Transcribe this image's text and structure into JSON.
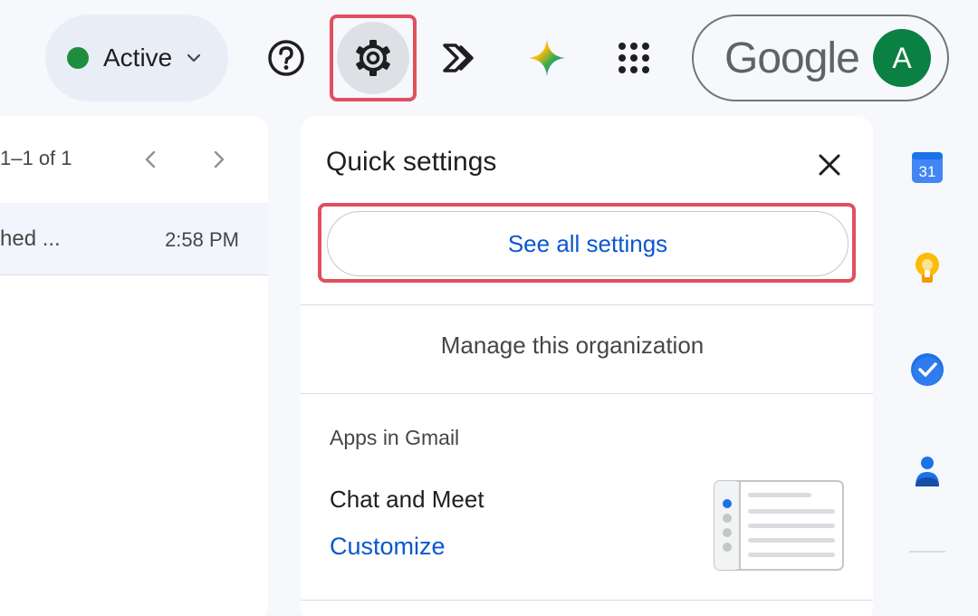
{
  "header": {
    "status_label": "Active",
    "status_color": "#1e8e3e",
    "icons": [
      "help-icon",
      "settings-icon",
      "apps-script-icon",
      "gemini-icon",
      "apps-grid-icon"
    ],
    "account_logo_text": "Google",
    "avatar_initial": "A",
    "avatar_color": "#0b8043"
  },
  "list": {
    "pager_text": "1–1 of 1",
    "rows": [
      {
        "snippet": "hed ...",
        "time": "2:58 PM"
      }
    ]
  },
  "quick_settings": {
    "title": "Quick settings",
    "see_all_label": "See all settings",
    "manage_org_label": "Manage this organization",
    "apps_heading": "Apps in Gmail",
    "chat_meet_label": "Chat and Meet",
    "customize_label": "Customize"
  },
  "side_rail": {
    "calendar_date": "31",
    "icons": [
      "calendar-icon",
      "keep-icon",
      "tasks-icon",
      "contacts-icon"
    ]
  },
  "colors": {
    "accent_blue": "#0b57d0",
    "highlight_red": "#e0505e"
  }
}
